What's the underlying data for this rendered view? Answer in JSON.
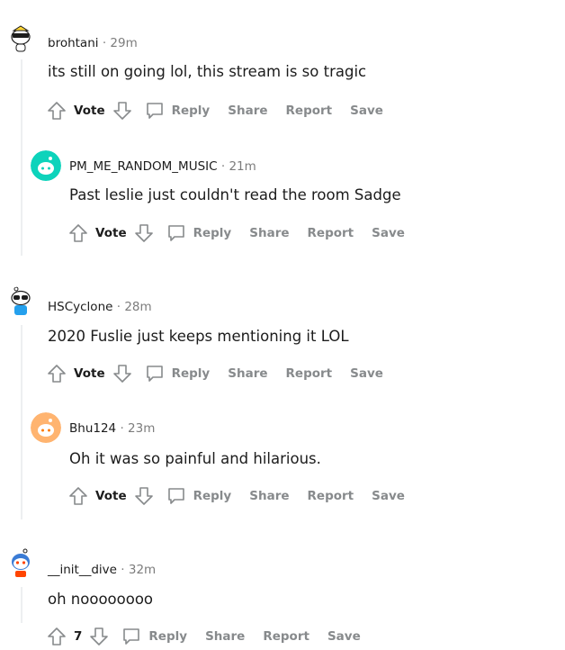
{
  "comments": [
    {
      "username": "brohtani",
      "sep": "·",
      "time": "29m",
      "text": "its still on going lol, this stream is so tragic",
      "vote": "Vote",
      "reply": "Reply",
      "share": "Share",
      "report": "Report",
      "save": "Save"
    },
    {
      "username": "PM_ME_RANDOM_MUSIC",
      "sep": "·",
      "time": "21m",
      "text": "Past leslie just couldn't read the room Sadge",
      "vote": "Vote",
      "reply": "Reply",
      "share": "Share",
      "report": "Report",
      "save": "Save"
    },
    {
      "username": "HSCyclone",
      "sep": "·",
      "time": "28m",
      "text": "2020 Fuslie just keeps mentioning it LOL",
      "vote": "Vote",
      "reply": "Reply",
      "share": "Share",
      "report": "Report",
      "save": "Save"
    },
    {
      "username": "Bhu124",
      "sep": "·",
      "time": "23m",
      "text": "Oh it was so painful and hilarious.",
      "vote": "Vote",
      "reply": "Reply",
      "share": "Share",
      "report": "Report",
      "save": "Save"
    },
    {
      "username": "__init__dive",
      "sep": "·",
      "time": "32m",
      "text": "oh noooooooo",
      "vote": "7",
      "reply": "Reply",
      "share": "Share",
      "report": "Report",
      "save": "Save"
    }
  ],
  "colors": {
    "muted": "#878a8c",
    "thread": "#edeff1",
    "teal": "#0dd3bb",
    "orange": "#ffb000"
  }
}
